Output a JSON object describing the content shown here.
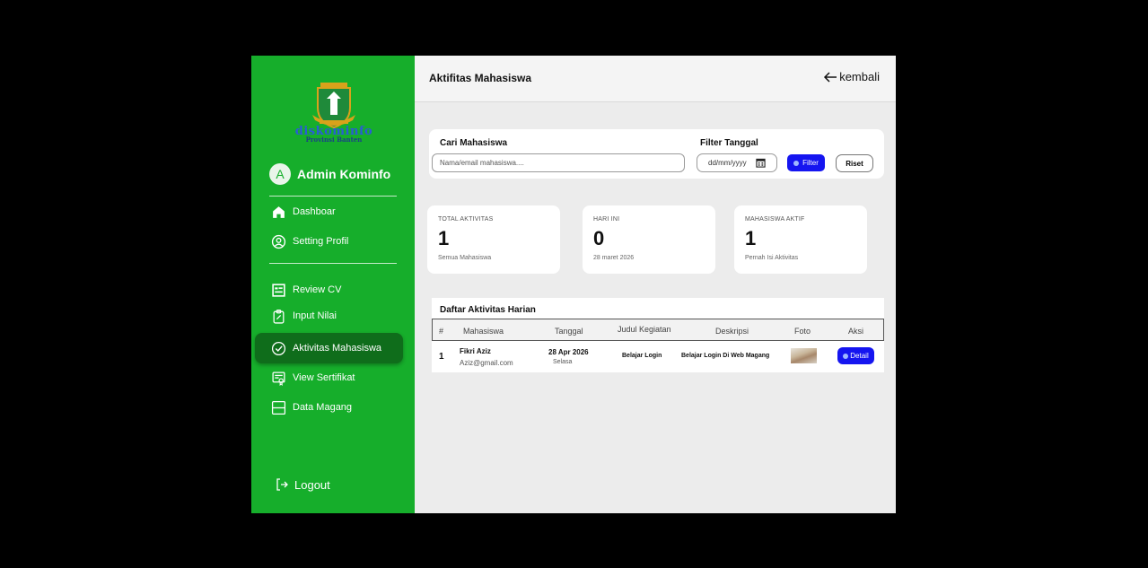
{
  "sidebar": {
    "logo_text": "diskominfo",
    "logo_subtext": "Provinsi Banten",
    "avatar_letter": "A",
    "admin_name": "Admin Kominfo",
    "items": [
      {
        "label": "Dashboar",
        "icon": "home-icon"
      },
      {
        "label": "Setting Profil",
        "icon": "user-circle-icon"
      },
      {
        "label": "Review CV",
        "icon": "review-cv-icon"
      },
      {
        "label": "Input Nilai",
        "icon": "clipboard-edit-icon"
      },
      {
        "label": "Aktivitas Mahasiswa",
        "icon": "check-circle-icon",
        "active": true
      },
      {
        "label": "View Sertifikat",
        "icon": "certificate-icon"
      },
      {
        "label": "Data Magang",
        "icon": "layout-icon"
      }
    ],
    "logout_label": "Logout"
  },
  "header": {
    "title": "Aktifitas Mahasiswa",
    "back_label": "kembali"
  },
  "filter": {
    "search_label": "Cari Mahasiswa",
    "search_placeholder": "Nama/email mahasiswa....",
    "date_label": "Filter Tanggal",
    "date_placeholder": "dd/mm/yyyy",
    "filter_button": "Filter",
    "reset_button": "Riset"
  },
  "stats": [
    {
      "label": "TOTAL AKTIVITAS",
      "value": "1",
      "sub": "Semua Mahasiswa"
    },
    {
      "label": "HARI INI",
      "value": "0",
      "sub": "28 maret 2026"
    },
    {
      "label": "MAHASISWA AKTIF",
      "value": "1",
      "sub": "Pernah Isi Aktivitas"
    }
  ],
  "table": {
    "title": "Daftar Aktivitas Harian",
    "columns": [
      "#",
      "Mahasiswa",
      "Tanggal",
      "Judul Kegiatan",
      "Deskripsi",
      "Foto",
      "Aksi"
    ],
    "rows": [
      {
        "no": "1",
        "name": "Fikri Aziz",
        "email": "Aziz@gmail.com",
        "date": "28 Apr 2026",
        "day": "Selasa",
        "title": "Belajar Login",
        "description": "Belajar Login Di Web Magang",
        "action": "Detail"
      }
    ]
  },
  "colors": {
    "sidebar_green": "#16ae2b",
    "active_green": "#0f6d1b",
    "primary_blue": "#1515f0"
  }
}
